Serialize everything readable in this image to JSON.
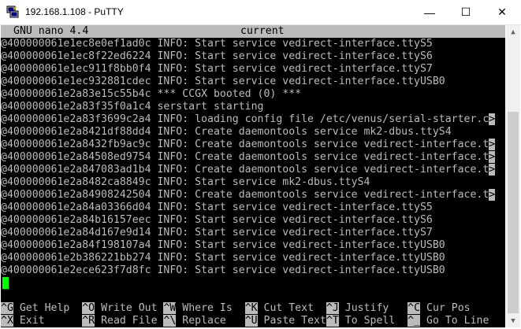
{
  "window": {
    "title": "192.168.1.108 - PuTTY",
    "minimize_glyph": "—",
    "maximize_glyph": "☐",
    "close_glyph": "✕"
  },
  "nano": {
    "version": "GNU nano 4.4",
    "filename": "current"
  },
  "log_lines": [
    {
      "text": "@400000061e1ec8e0ef1ad0c INFO: Start service vedirect-interface.ttyS5",
      "trunc": ""
    },
    {
      "text": "@400000061e1ec8f22ed6224 INFO: Start service vedirect-interface.ttyS6",
      "trunc": ""
    },
    {
      "text": "@400000061e1ec911f8bb0f4 INFO: Start service vedirect-interface.ttyS7",
      "trunc": ""
    },
    {
      "text": "@400000061e1ec932881cdec INFO: Start service vedirect-interface.ttyUSB0",
      "trunc": ""
    },
    {
      "text": "@400000061e2a83e15c55b4c *** CCGX booted (0) ***",
      "trunc": ""
    },
    {
      "text": "@400000061e2a83f35f0a1c4 serstart starting",
      "trunc": ""
    },
    {
      "text": "@400000061e2a83f3699c2a4 INFO: loading config file /etc/venus/serial-starter.c",
      "trunc": ">"
    },
    {
      "text": "@400000061e2a8421df88dd4 INFO: Create daemontools service mk2-dbus.ttyS4",
      "trunc": ""
    },
    {
      "text": "@400000061e2a8432fb9ac9c INFO: Create daemontools service vedirect-interface.t",
      "trunc": ">"
    },
    {
      "text": "@400000061e2a84508ed9754 INFO: Create daemontools service vedirect-interface.t",
      "trunc": ">"
    },
    {
      "text": "@400000061e2a847083ad1b4 INFO: Create daemontools service vedirect-interface.t",
      "trunc": ">"
    },
    {
      "text": "@400000061e2a8482ca8849c INFO: Start service mk2-dbus.ttyS4",
      "trunc": ""
    },
    {
      "text": "@400000061e2a84908242504 INFO: Create daemontools service vedirect-interface.t",
      "trunc": ">"
    },
    {
      "text": "@400000061e2a84a03366d04 INFO: Start service vedirect-interface.ttyS5",
      "trunc": ""
    },
    {
      "text": "@400000061e2a84b16157eec INFO: Start service vedirect-interface.ttyS6",
      "trunc": ""
    },
    {
      "text": "@400000061e2a84d167e9d14 INFO: Start service vedirect-interface.ttyS7",
      "trunc": ""
    },
    {
      "text": "@400000061e2a84f198107a4 INFO: Start service vedirect-interface.ttyUSB0",
      "trunc": ""
    },
    {
      "text": "@400000061e2b386221bb274 INFO: Start service vedirect-interface.ttyUSB0",
      "trunc": ""
    },
    {
      "text": "@400000061e2ece623f7d8fc INFO: Start service vedirect-interface.ttyUSB0",
      "trunc": ""
    }
  ],
  "shortcuts_row1": [
    {
      "key": "^G",
      "label": " Get Help  "
    },
    {
      "key": "^O",
      "label": " Write Out "
    },
    {
      "key": "^W",
      "label": " Where Is  "
    },
    {
      "key": "^K",
      "label": " Cut Text  "
    },
    {
      "key": "^J",
      "label": " Justify   "
    },
    {
      "key": "^C",
      "label": " Cur Pos"
    }
  ],
  "shortcuts_row2": [
    {
      "key": "^X",
      "label": " Exit      "
    },
    {
      "key": "^R",
      "label": " Read File "
    },
    {
      "key": "^\\",
      "label": " Replace   "
    },
    {
      "key": "^U",
      "label": " Paste Text"
    },
    {
      "key": "^T",
      "label": " To Spell  "
    },
    {
      "key": "^_",
      "label": " Go To Line"
    }
  ],
  "colors": {
    "terminal_bg": "#000000",
    "terminal_fg": "#bbbbbb",
    "cursor": "#00ff00"
  }
}
